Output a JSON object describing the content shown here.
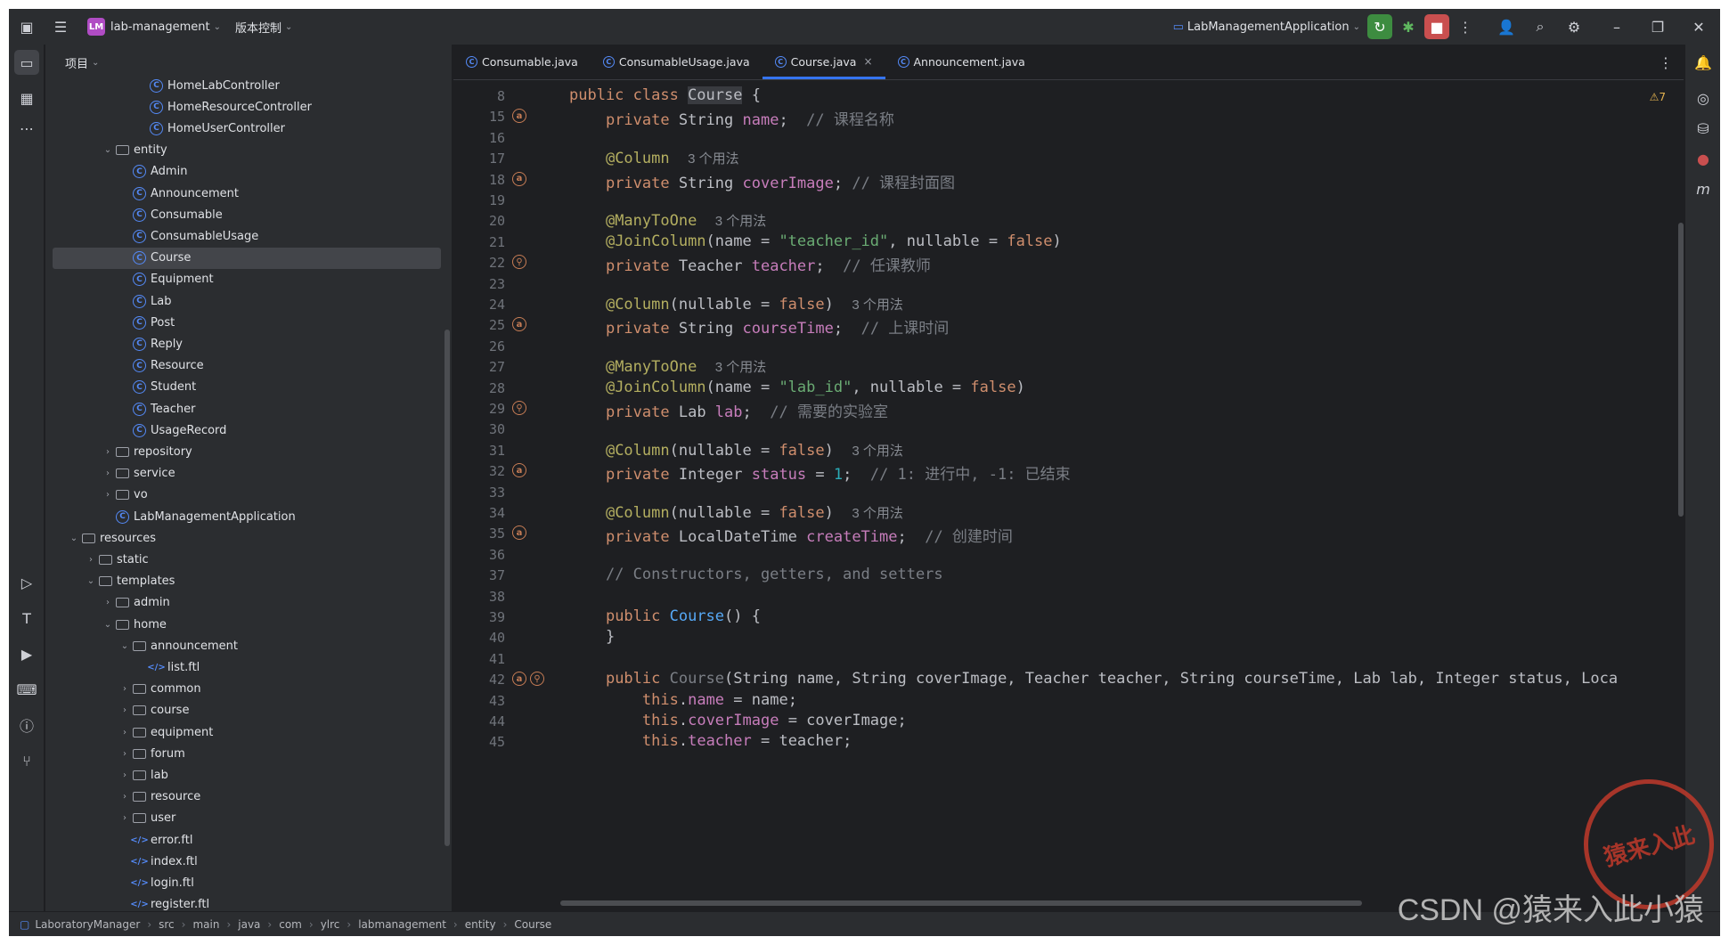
{
  "titlebar": {
    "project_badge": "LM",
    "project_name": "lab-management",
    "vcs": "版本控制",
    "run_config": "LabManagementApplication"
  },
  "project_panel": {
    "title": "项目",
    "tree": [
      {
        "label": "HomeLabController",
        "type": "class",
        "depth": 7
      },
      {
        "label": "HomeResourceController",
        "type": "class",
        "depth": 7
      },
      {
        "label": "HomeUserController",
        "type": "class",
        "depth": 7
      },
      {
        "label": "entity",
        "type": "folder",
        "depth": 5,
        "open": true
      },
      {
        "label": "Admin",
        "type": "class",
        "depth": 6
      },
      {
        "label": "Announcement",
        "type": "class",
        "depth": 6
      },
      {
        "label": "Consumable",
        "type": "class",
        "depth": 6
      },
      {
        "label": "ConsumableUsage",
        "type": "class",
        "depth": 6
      },
      {
        "label": "Course",
        "type": "class",
        "depth": 6,
        "selected": true
      },
      {
        "label": "Equipment",
        "type": "class",
        "depth": 6
      },
      {
        "label": "Lab",
        "type": "class",
        "depth": 6
      },
      {
        "label": "Post",
        "type": "class",
        "depth": 6
      },
      {
        "label": "Reply",
        "type": "class",
        "depth": 6
      },
      {
        "label": "Resource",
        "type": "class",
        "depth": 6
      },
      {
        "label": "Student",
        "type": "class",
        "depth": 6
      },
      {
        "label": "Teacher",
        "type": "class",
        "depth": 6
      },
      {
        "label": "UsageRecord",
        "type": "class",
        "depth": 6
      },
      {
        "label": "repository",
        "type": "folder",
        "depth": 5,
        "open": false
      },
      {
        "label": "service",
        "type": "folder",
        "depth": 5,
        "open": false
      },
      {
        "label": "vo",
        "type": "folder",
        "depth": 5,
        "open": false
      },
      {
        "label": "LabManagementApplication",
        "type": "class",
        "depth": 5
      },
      {
        "label": "resources",
        "type": "folder",
        "depth": 3,
        "open": true
      },
      {
        "label": "static",
        "type": "folder",
        "depth": 4,
        "open": false
      },
      {
        "label": "templates",
        "type": "folder",
        "depth": 4,
        "open": true
      },
      {
        "label": "admin",
        "type": "folder",
        "depth": 5,
        "open": false
      },
      {
        "label": "home",
        "type": "folder",
        "depth": 5,
        "open": true
      },
      {
        "label": "announcement",
        "type": "folder",
        "depth": 6,
        "open": true
      },
      {
        "label": "list.ftl",
        "type": "ftl",
        "depth": 7
      },
      {
        "label": "common",
        "type": "folder",
        "depth": 6,
        "open": false
      },
      {
        "label": "course",
        "type": "folder",
        "depth": 6,
        "open": false
      },
      {
        "label": "equipment",
        "type": "folder",
        "depth": 6,
        "open": false
      },
      {
        "label": "forum",
        "type": "folder",
        "depth": 6,
        "open": false
      },
      {
        "label": "lab",
        "type": "folder",
        "depth": 6,
        "open": false
      },
      {
        "label": "resource",
        "type": "folder",
        "depth": 6,
        "open": false
      },
      {
        "label": "user",
        "type": "folder",
        "depth": 6,
        "open": false
      },
      {
        "label": "error.ftl",
        "type": "ftl",
        "depth": 6
      },
      {
        "label": "index.ftl",
        "type": "ftl",
        "depth": 6
      },
      {
        "label": "login.ftl",
        "type": "ftl",
        "depth": 6
      },
      {
        "label": "register.ftl",
        "type": "ftl",
        "depth": 6
      }
    ]
  },
  "tabs": [
    {
      "label": "Consumable.java",
      "active": false
    },
    {
      "label": "ConsumableUsage.java",
      "active": false
    },
    {
      "label": "Course.java",
      "active": true
    },
    {
      "label": "Announcement.java",
      "active": false
    }
  ],
  "warnings": "⚠7",
  "code_lines": [
    {
      "n": "8",
      "html": "<span class='kw'>public class </span><span class='ty' style='background:#393b40'>Course</span> {"
    },
    {
      "n": "15",
      "g": "a",
      "html": "    <span class='kw'>private </span>String <span class='fd'>name</span>;  <span class='cm'>// 课程名称</span>"
    },
    {
      "n": "16",
      "html": ""
    },
    {
      "n": "17",
      "html": "    <span class='an'>@Column</span>  <span class='hint'>3 个用法</span>"
    },
    {
      "n": "18",
      "g": "a",
      "html": "    <span class='kw'>private </span>String <span class='fd'>coverImage</span>; <span class='cm'>// 课程封面图</span>"
    },
    {
      "n": "19",
      "html": ""
    },
    {
      "n": "20",
      "html": "    <span class='an'>@ManyToOne</span>  <span class='hint'>3 个用法</span>"
    },
    {
      "n": "21",
      "html": "    <span class='an'>@JoinColumn</span>(name = <span class='st'>\"teacher_id\"</span>, nullable = <span class='kw'>false</span>)"
    },
    {
      "n": "22",
      "g": "l",
      "html": "    <span class='kw'>private </span>Teacher <span class='fd'>teacher</span>;  <span class='cm'>// 任课教师</span>"
    },
    {
      "n": "23",
      "html": ""
    },
    {
      "n": "24",
      "html": "    <span class='an'>@Column</span>(nullable = <span class='kw'>false</span>)  <span class='hint'>3 个用法</span>"
    },
    {
      "n": "25",
      "g": "a",
      "html": "    <span class='kw'>private </span>String <span class='fd'>courseTime</span>;  <span class='cm'>// 上课时间</span>"
    },
    {
      "n": "26",
      "html": ""
    },
    {
      "n": "27",
      "html": "    <span class='an'>@ManyToOne</span>  <span class='hint'>3 个用法</span>"
    },
    {
      "n": "28",
      "html": "    <span class='an'>@JoinColumn</span>(name = <span class='st'>\"lab_id\"</span>, nullable = <span class='kw'>false</span>)"
    },
    {
      "n": "29",
      "g": "l",
      "html": "    <span class='kw'>private </span>Lab <span class='fd'>lab</span>;  <span class='cm'>// 需要的实验室</span>"
    },
    {
      "n": "30",
      "html": ""
    },
    {
      "n": "31",
      "html": "    <span class='an'>@Column</span>(nullable = <span class='kw'>false</span>)  <span class='hint'>3 个用法</span>"
    },
    {
      "n": "32",
      "g": "a",
      "html": "    <span class='kw'>private </span>Integer <span class='fd'>status</span> = <span class='nu'>1</span>;  <span class='cm'>// 1: 进行中, -1: 已结束</span>"
    },
    {
      "n": "33",
      "html": ""
    },
    {
      "n": "34",
      "html": "    <span class='an'>@Column</span>(nullable = <span class='kw'>false</span>)  <span class='hint'>3 个用法</span>"
    },
    {
      "n": "35",
      "g": "a",
      "html": "    <span class='kw'>private </span>LocalDateTime <span class='fd'>createTime</span>;  <span class='cm'>// 创建时间</span>"
    },
    {
      "n": "36",
      "html": ""
    },
    {
      "n": "37",
      "html": "    <span class='cm'>// Constructors, getters, and setters</span>"
    },
    {
      "n": "38",
      "html": ""
    },
    {
      "n": "39",
      "html": "    <span class='kw'>public </span><span class='mt'>Course</span>() {"
    },
    {
      "n": "40",
      "html": "    }"
    },
    {
      "n": "41",
      "html": ""
    },
    {
      "n": "42",
      "g": "al",
      "html": "    <span class='kw'>public </span><span class='cm'>Course</span>(String name, String coverImage, Teacher teacher, String courseTime, Lab lab, Integer status, Loca"
    },
    {
      "n": "43",
      "html": "        <span class='kw'>this</span>.<span class='fd'>name</span> = name;"
    },
    {
      "n": "44",
      "html": "        <span class='kw'>this</span>.<span class='fd'>coverImage</span> = coverImage;"
    },
    {
      "n": "45",
      "html": "        <span class='kw'>this</span>.<span class='fd'>teacher</span> = teacher;"
    }
  ],
  "breadcrumbs": [
    "LaboratoryManager",
    "src",
    "main",
    "java",
    "com",
    "ylrc",
    "labmanagement",
    "entity",
    "Course"
  ],
  "watermark": "CSDN @猿来入此小猿",
  "stamp_text": "猿来入此"
}
